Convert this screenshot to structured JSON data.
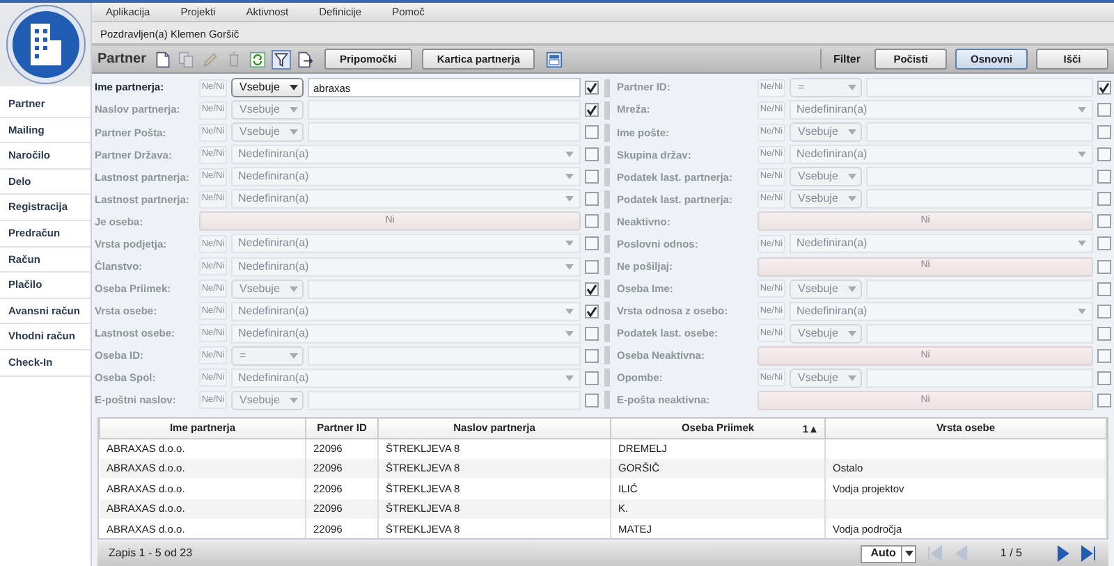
{
  "menu": [
    "Aplikacija",
    "Projekti",
    "Aktivnost",
    "Definicije",
    "Pomoč"
  ],
  "greeting": "Pozdravljen(a) Klemen Goršič",
  "sidebar": {
    "items": [
      "Partner",
      "Mailing",
      "Naročilo",
      "Delo",
      "Registracija",
      "Predračun",
      "Račun",
      "Plačilo",
      "Avansni račun",
      "Vhodni račun",
      "Check-In"
    ]
  },
  "toolbar": {
    "title": "Partner",
    "icons": [
      {
        "kind": "new",
        "disabled": false,
        "selected": false
      },
      {
        "kind": "copy",
        "disabled": true,
        "selected": false
      },
      {
        "kind": "edit",
        "disabled": true,
        "selected": false
      },
      {
        "kind": "delete",
        "disabled": true,
        "selected": false
      },
      {
        "kind": "refresh",
        "disabled": false,
        "selected": false
      },
      {
        "kind": "filter",
        "disabled": false,
        "selected": true
      },
      {
        "kind": "export",
        "disabled": false,
        "selected": false
      }
    ],
    "buttons": [
      "Pripomočki",
      "Kartica partnerja"
    ],
    "filter_label": "Filter",
    "filter_buttons": [
      {
        "label": "Počisti",
        "selected": false
      },
      {
        "label": "Osnovni",
        "selected": true
      },
      {
        "label": "Išči",
        "selected": false
      }
    ]
  },
  "filters_left": [
    {
      "label": "Ime partnerja:",
      "kind": "text",
      "active": true,
      "negate": "Ne/Ni",
      "operator": "Vsebuje",
      "value": "abraxas",
      "checked": true
    },
    {
      "label": "Naslov partnerja:",
      "kind": "text",
      "active": false,
      "negate": "Ne/Ni",
      "operator": "Vsebuje",
      "checked": true
    },
    {
      "label": "Partner Pošta:",
      "kind": "text",
      "active": false,
      "negate": "Ne/Ni",
      "operator": "Vsebuje",
      "checked": false
    },
    {
      "label": "Partner Država:",
      "kind": "select",
      "active": false,
      "negate": "Ne/Ni",
      "option": "Nedefiniran(a)",
      "checked": false
    },
    {
      "label": "Lastnost partnerja:",
      "kind": "select",
      "active": false,
      "negate": "Ne/Ni",
      "option": "Nedefiniran(a)",
      "checked": false
    },
    {
      "label": "Lastnost partnerja:",
      "kind": "select",
      "active": false,
      "negate": "Ne/Ni",
      "option": "Nedefiniran(a)",
      "checked": false
    },
    {
      "label": "Je oseba:",
      "kind": "toggle",
      "active": false,
      "toggle": "Ni",
      "checked": false
    },
    {
      "label": "Vrsta podjetja:",
      "kind": "select",
      "active": false,
      "negate": "Ne/Ni",
      "option": "Nedefiniran(a)",
      "checked": false
    },
    {
      "label": "Članstvo:",
      "kind": "select",
      "active": false,
      "negate": "Ne/Ni",
      "option": "Nedefiniran(a)",
      "checked": false
    },
    {
      "label": "Oseba Priimek:",
      "kind": "text",
      "active": false,
      "negate": "Ne/Ni",
      "operator": "Vsebuje",
      "checked": true
    },
    {
      "label": "Vrsta osebe:",
      "kind": "select",
      "active": false,
      "negate": "Ne/Ni",
      "option": "Nedefiniran(a)",
      "checked": true
    },
    {
      "label": "Lastnost osebe:",
      "kind": "select",
      "active": false,
      "negate": "Ne/Ni",
      "option": "Nedefiniran(a)",
      "checked": false
    },
    {
      "label": "Oseba ID:",
      "kind": "text",
      "active": false,
      "negate": "Ne/Ni",
      "operator": "=",
      "checked": false
    },
    {
      "label": "Oseba Spol:",
      "kind": "select",
      "active": false,
      "negate": "Ne/Ni",
      "option": "Nedefiniran(a)",
      "checked": false
    },
    {
      "label": "E-poštni naslov:",
      "kind": "text",
      "active": false,
      "negate": "Ne/Ni",
      "operator": "Vsebuje",
      "checked": false
    }
  ],
  "filters_right": [
    {
      "label": "Partner ID:",
      "kind": "text",
      "active": false,
      "negate": "Ne/Ni",
      "operator": "=",
      "checked": true
    },
    {
      "label": "Mreža:",
      "kind": "select",
      "active": false,
      "negate": "Ne/Ni",
      "option": "Nedefiniran(a)",
      "checked": false
    },
    {
      "label": "Ime pošte:",
      "kind": "text",
      "active": false,
      "negate": "Ne/Ni",
      "operator": "Vsebuje",
      "checked": false
    },
    {
      "label": "Skupina držav:",
      "kind": "select",
      "active": false,
      "negate": "Ne/Ni",
      "option": "Nedefiniran(a)",
      "checked": false
    },
    {
      "label": "Podatek last. partnerja:",
      "kind": "text",
      "active": false,
      "negate": "Ne/Ni",
      "operator": "Vsebuje",
      "checked": false
    },
    {
      "label": "Podatek last. partnerja:",
      "kind": "text",
      "active": false,
      "negate": "Ne/Ni",
      "operator": "Vsebuje",
      "checked": false
    },
    {
      "label": "Neaktivno:",
      "kind": "toggle",
      "active": false,
      "toggle": "Ni",
      "checked": false
    },
    {
      "label": "Poslovni odnos:",
      "kind": "select",
      "active": false,
      "negate": "Ne/Ni",
      "option": "Nedefiniran(a)",
      "checked": false
    },
    {
      "label": "Ne pošiljaj:",
      "kind": "toggle",
      "active": false,
      "toggle": "Ni",
      "checked": false
    },
    {
      "label": "Oseba Ime:",
      "kind": "text",
      "active": false,
      "negate": "Ne/Ni",
      "operator": "Vsebuje",
      "checked": false
    },
    {
      "label": "Vrsta odnosa z osebo:",
      "kind": "select",
      "active": false,
      "negate": "Ne/Ni",
      "option": "Nedefiniran(a)",
      "checked": false
    },
    {
      "label": "Podatek last. osebe:",
      "kind": "text",
      "active": false,
      "negate": "Ne/Ni",
      "operator": "Vsebuje",
      "checked": false
    },
    {
      "label": "Oseba Neaktivna:",
      "kind": "toggle",
      "active": false,
      "toggle": "Ni",
      "checked": false
    },
    {
      "label": "Opombe:",
      "kind": "text",
      "active": false,
      "negate": "Ne/Ni",
      "operator": "Vsebuje",
      "checked": false
    },
    {
      "label": "E-pošta neaktivna:",
      "kind": "toggle",
      "active": false,
      "toggle": "Ni",
      "checked": false
    }
  ],
  "table": {
    "columns": [
      {
        "label": "Ime partnerja"
      },
      {
        "label": "Partner ID"
      },
      {
        "label": "Naslov partnerja"
      },
      {
        "label": "Oseba Priimek",
        "sort": "1▲"
      },
      {
        "label": "Vrsta osebe"
      }
    ],
    "rows": [
      [
        "ABRAXAS d.o.o.",
        "22096",
        "ŠTREKLJEVA 8",
        "DREMELJ",
        null
      ],
      [
        "ABRAXAS d.o.o.",
        "22096",
        "ŠTREKLJEVA 8",
        "GORŠIČ",
        "Ostalo"
      ],
      [
        "ABRAXAS d.o.o.",
        "22096",
        "ŠTREKLJEVA 8",
        "ILIĆ",
        "Vodja projektov"
      ],
      [
        "ABRAXAS d.o.o.",
        "22096",
        "ŠTREKLJEVA 8",
        "K.",
        null
      ],
      [
        "ABRAXAS d.o.o.",
        "22096",
        "ŠTREKLJEVA 8",
        "MATEJ",
        "Vodja področja"
      ]
    ]
  },
  "pager": {
    "summary": "Zapis 1 - 5 od 23",
    "page_size": "Auto",
    "page": "1 / 5",
    "buttons": [
      {
        "kind": "first",
        "disabled": true
      },
      {
        "kind": "prev",
        "disabled": true
      },
      {
        "kind": "next",
        "disabled": false
      },
      {
        "kind": "last",
        "disabled": false
      }
    ]
  }
}
